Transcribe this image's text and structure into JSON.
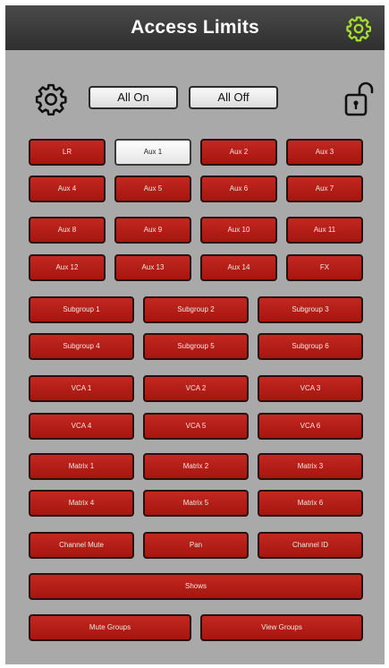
{
  "header": {
    "title": "Access Limits"
  },
  "controls": {
    "all_on": "All On",
    "all_off": "All Off"
  },
  "colors": {
    "accent": "#a4e02a",
    "button_red": "#b81e16",
    "button_on": "#f2f2f2",
    "panel": "#a9a9a9",
    "header": "#3a3a3a"
  },
  "icons": {
    "header": "gear-icon",
    "settings": "settings-gear-icon",
    "lock": "unlocked-padlock-icon"
  },
  "buses": [
    {
      "label": "LR",
      "selected": false
    },
    {
      "label": "Aux 1",
      "selected": true
    },
    {
      "label": "Aux 2",
      "selected": false
    },
    {
      "label": "Aux 3",
      "selected": false
    },
    {
      "label": "Aux 4",
      "selected": false
    },
    {
      "label": "Aux 5",
      "selected": false
    },
    {
      "label": "Aux 6",
      "selected": false
    },
    {
      "label": "Aux 7",
      "selected": false
    },
    {
      "label": "Aux 8",
      "selected": false
    },
    {
      "label": "Aux 9",
      "selected": false
    },
    {
      "label": "Aux 10",
      "selected": false
    },
    {
      "label": "Aux 11",
      "selected": false
    },
    {
      "label": "Aux 12",
      "selected": false
    },
    {
      "label": "Aux 13",
      "selected": false
    },
    {
      "label": "Aux 14",
      "selected": false
    },
    {
      "label": "FX",
      "selected": false
    }
  ],
  "groups": [
    {
      "label": "Subgroup 1"
    },
    {
      "label": "Subgroup 2"
    },
    {
      "label": "Subgroup 3"
    },
    {
      "label": "Subgroup 4"
    },
    {
      "label": "Subgroup 5"
    },
    {
      "label": "Subgroup 6"
    },
    {
      "label": "VCA 1"
    },
    {
      "label": "VCA 2"
    },
    {
      "label": "VCA 3"
    },
    {
      "label": "VCA 4"
    },
    {
      "label": "VCA 5"
    },
    {
      "label": "VCA 6"
    },
    {
      "label": "Matrix 1"
    },
    {
      "label": "Matrix 2"
    },
    {
      "label": "Matrix 3"
    },
    {
      "label": "Matrix 4"
    },
    {
      "label": "Matrix 5"
    },
    {
      "label": "Matrix 6"
    },
    {
      "label": "Channel Mute"
    },
    {
      "label": "Pan"
    },
    {
      "label": "Channel ID"
    }
  ],
  "shows": {
    "label": "Shows"
  },
  "bottom": [
    {
      "label": "Mute Groups"
    },
    {
      "label": "View Groups"
    }
  ]
}
